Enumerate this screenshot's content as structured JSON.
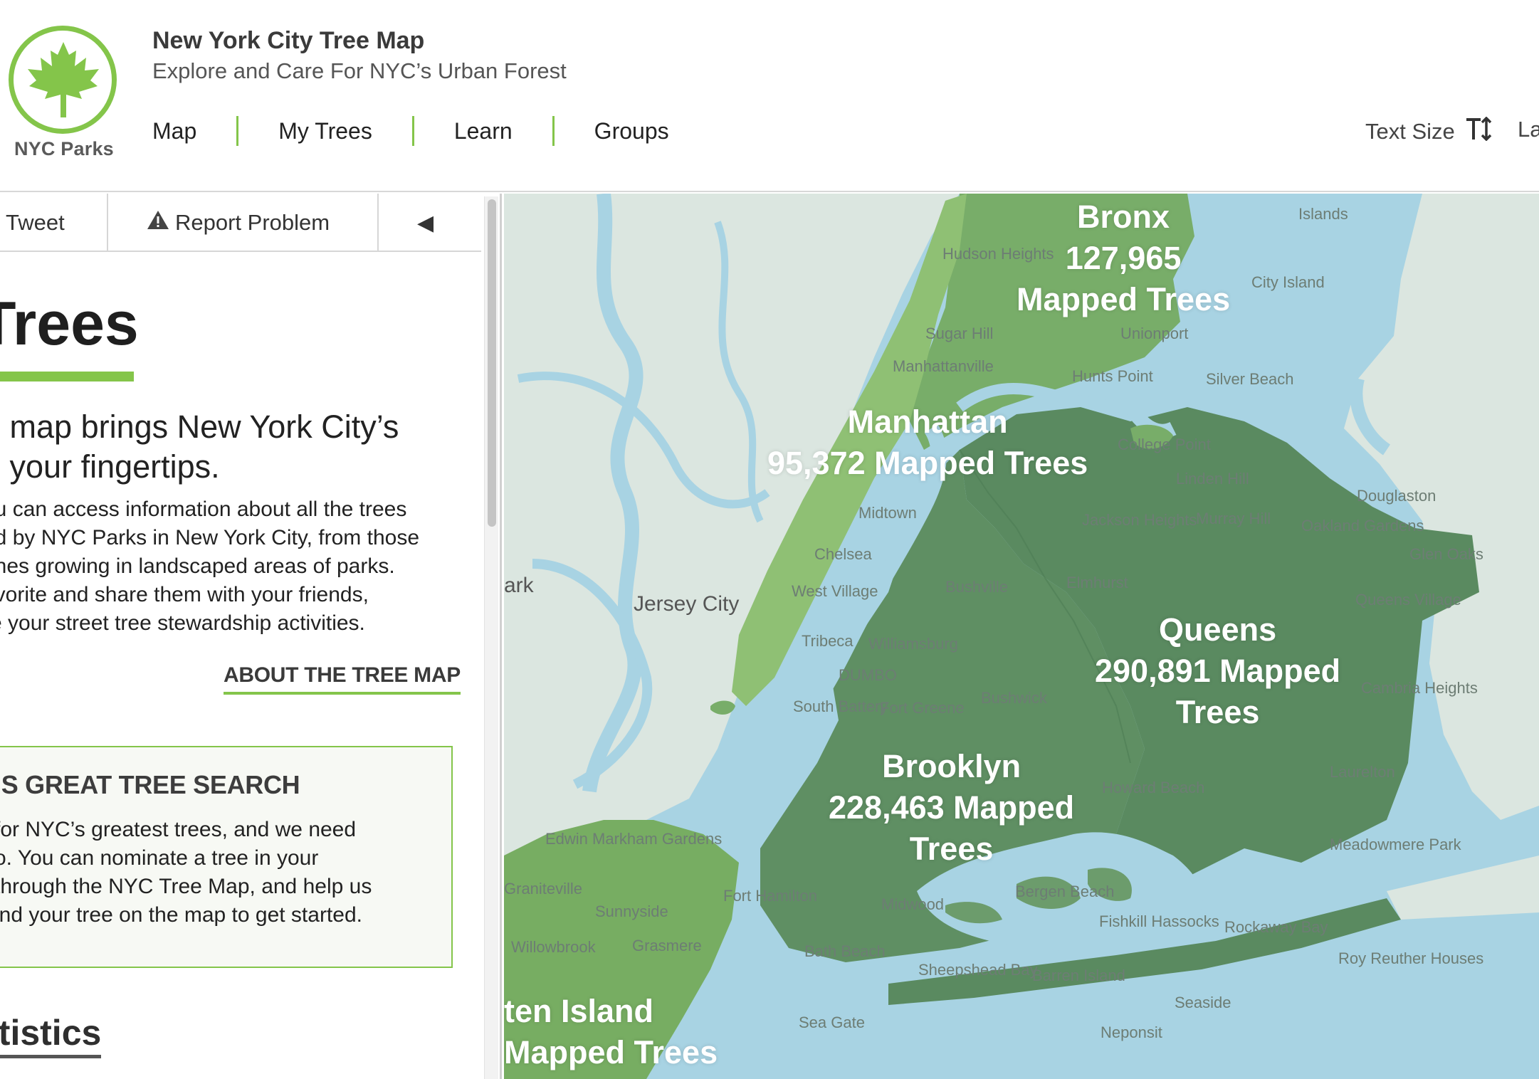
{
  "header": {
    "logo_text": "NYC Parks",
    "title": "New York City Tree Map",
    "subtitle": "Explore and Care For NYC’s Urban Forest",
    "nav": [
      "Map",
      "My Trees",
      "Learn",
      "Groups"
    ],
    "text_size_label": "Text Size",
    "text_size_icon": "TI",
    "language_label": "La"
  },
  "toolbar": {
    "tweet": "Tweet",
    "report": "Report Problem",
    "collapse_icon": "◀"
  },
  "sidebar": {
    "title": "Trees",
    "lead_lines": [
      "e map brings New York City’s",
      "o your fingertips."
    ],
    "body_lines": [
      "ou can access information about all the trees",
      "ed by NYC Parks in New York City, from those",
      "ones growing in landscaped areas of parks.",
      "avorite and share them with your friends,",
      "re your street tree stewardship activities."
    ],
    "about_link": "ABOUT THE TREE MAP",
    "search_title": "’S GREAT TREE SEARCH",
    "search_lines": [
      "for NYC’s greatest trees, and we need",
      "o. You can nominate a tree in your",
      "through the NYC Tree Map, and help us",
      "ind your tree on the map to get started."
    ],
    "stats_title": "atistics"
  },
  "map": {
    "boroughs": [
      {
        "id": "bronx",
        "lines": [
          "Bronx",
          "127,965",
          "Mapped Trees"
        ],
        "count": 127965,
        "color": "#78ad69"
      },
      {
        "id": "manhattan",
        "lines": [
          "Manhattan",
          "95,372 Mapped Trees"
        ],
        "count": 95372,
        "color": "#8fc074"
      },
      {
        "id": "queens",
        "lines": [
          "Queens",
          "290,891 Mapped",
          "Trees"
        ],
        "count": 290891,
        "color": "#5a8a60"
      },
      {
        "id": "brooklyn",
        "lines": [
          "Brooklyn",
          "228,463 Mapped",
          "Trees"
        ],
        "count": 228463,
        "color": "#5f8f63"
      },
      {
        "id": "staten-island",
        "lines": [
          "ten Island",
          "Mapped Trees"
        ],
        "color": "#77ad62"
      }
    ],
    "places": [
      "Hudson Heights",
      "City Island",
      "Sugar Hill",
      "Unionport",
      "Manhattanville",
      "Hunts Point",
      "Silver Beach",
      "College Point",
      "Linden Hill",
      "Douglaston",
      "Midtown",
      "Jackson Heights",
      "Murray Hill",
      "Oakland Gardens",
      "Glen Oaks",
      "Chelsea",
      "Elmhurst",
      "West Village",
      "Bushwick",
      "Queens Village",
      "Tribeca",
      "Williamsburg",
      "DUMBO",
      "Fort Greene",
      "South Battery",
      "Cambria Heights",
      "Laurelton",
      "Howard Beach",
      "Jersey City",
      "ark",
      "Edwin Markham Gardens",
      "Graniteville",
      "Sunnyside",
      "Fort Hamilton",
      "Midwood",
      "Bergen Beach",
      "Fishkill Hassocks",
      "Rockaway Bay",
      "Meadowmere Park",
      "Willowbrook",
      "Grasmere",
      "Bath Beach",
      "Sheepshead Bay",
      "Barren Island",
      "Roy Reuther Houses",
      "Seaside",
      "Sea Gate",
      "Neponsit",
      "Islands",
      "Bushville"
    ]
  }
}
